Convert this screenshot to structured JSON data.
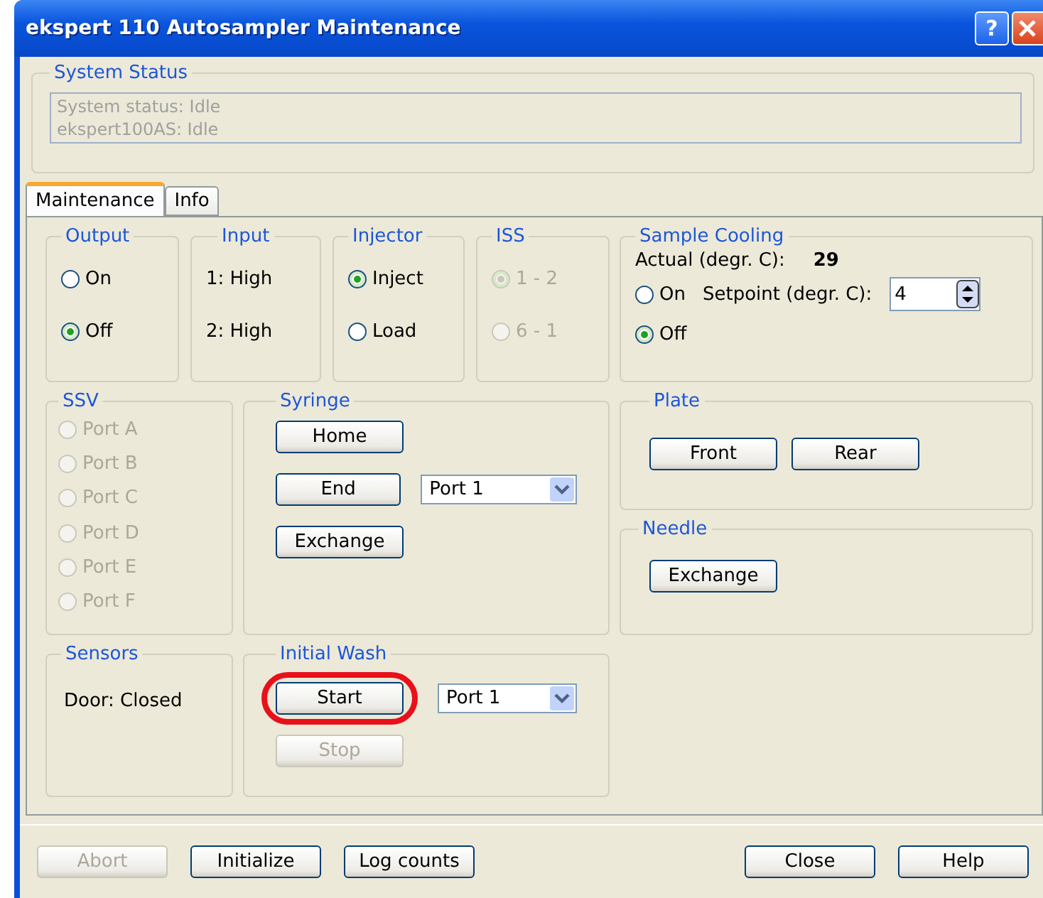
{
  "window": {
    "title": "ekspert 110 Autosampler Maintenance",
    "help_glyph": "?"
  },
  "system_status": {
    "label": "System Status",
    "lines": [
      "System status: Idle",
      "ekspert100AS: Idle"
    ]
  },
  "tabs": [
    {
      "label": "Maintenance",
      "selected": true
    },
    {
      "label": "Info",
      "selected": false
    }
  ],
  "output": {
    "label": "Output",
    "options": [
      {
        "label": "On",
        "selected": false,
        "disabled": false
      },
      {
        "label": "Off",
        "selected": true,
        "disabled": false
      }
    ]
  },
  "input": {
    "label": "Input",
    "lines": [
      "1: High",
      "2: High"
    ]
  },
  "injector": {
    "label": "Injector",
    "options": [
      {
        "label": "Inject",
        "selected": true,
        "disabled": false
      },
      {
        "label": "Load",
        "selected": false,
        "disabled": false
      }
    ]
  },
  "iss": {
    "label": "ISS",
    "options": [
      {
        "label": "1 - 2",
        "selected": true,
        "disabled": true
      },
      {
        "label": "6 - 1",
        "selected": false,
        "disabled": true
      }
    ]
  },
  "sample_cooling": {
    "label": "Sample Cooling",
    "actual_label": "Actual (degr. C):",
    "actual_value": "29",
    "options": [
      {
        "label": "On",
        "selected": false,
        "disabled": false
      },
      {
        "label": "Off",
        "selected": true,
        "disabled": false
      }
    ],
    "setpoint_label": "Setpoint (degr. C):",
    "setpoint_value": "4"
  },
  "ssv": {
    "label": "SSV",
    "options": [
      {
        "label": "Port A",
        "selected": false,
        "disabled": true
      },
      {
        "label": "Port B",
        "selected": false,
        "disabled": true
      },
      {
        "label": "Port C",
        "selected": false,
        "disabled": true
      },
      {
        "label": "Port D",
        "selected": false,
        "disabled": true
      },
      {
        "label": "Port E",
        "selected": false,
        "disabled": true
      },
      {
        "label": "Port F",
        "selected": false,
        "disabled": true
      }
    ]
  },
  "syringe": {
    "label": "Syringe",
    "home": "Home",
    "end": "End",
    "port": "Port 1",
    "exchange": "Exchange"
  },
  "plate": {
    "label": "Plate",
    "buttons": [
      {
        "label": "Front",
        "disabled": false
      },
      {
        "label": "Rear",
        "disabled": false
      }
    ]
  },
  "needle": {
    "label": "Needle",
    "button": "Exchange"
  },
  "sensors": {
    "label": "Sensors",
    "door": "Door: Closed"
  },
  "initial_wash": {
    "label": "Initial Wash",
    "start": {
      "label": "Start",
      "disabled": false,
      "highlighted": true
    },
    "port": "Port 1",
    "stop": {
      "label": "Stop",
      "disabled": true,
      "highlighted": false
    }
  },
  "footer": {
    "left": [
      {
        "label": "Abort",
        "disabled": true
      },
      {
        "label": "Initialize",
        "disabled": false
      },
      {
        "label": "Log counts",
        "disabled": false
      }
    ],
    "right": [
      {
        "label": "Close",
        "disabled": false
      },
      {
        "label": "Help",
        "disabled": false
      }
    ]
  }
}
